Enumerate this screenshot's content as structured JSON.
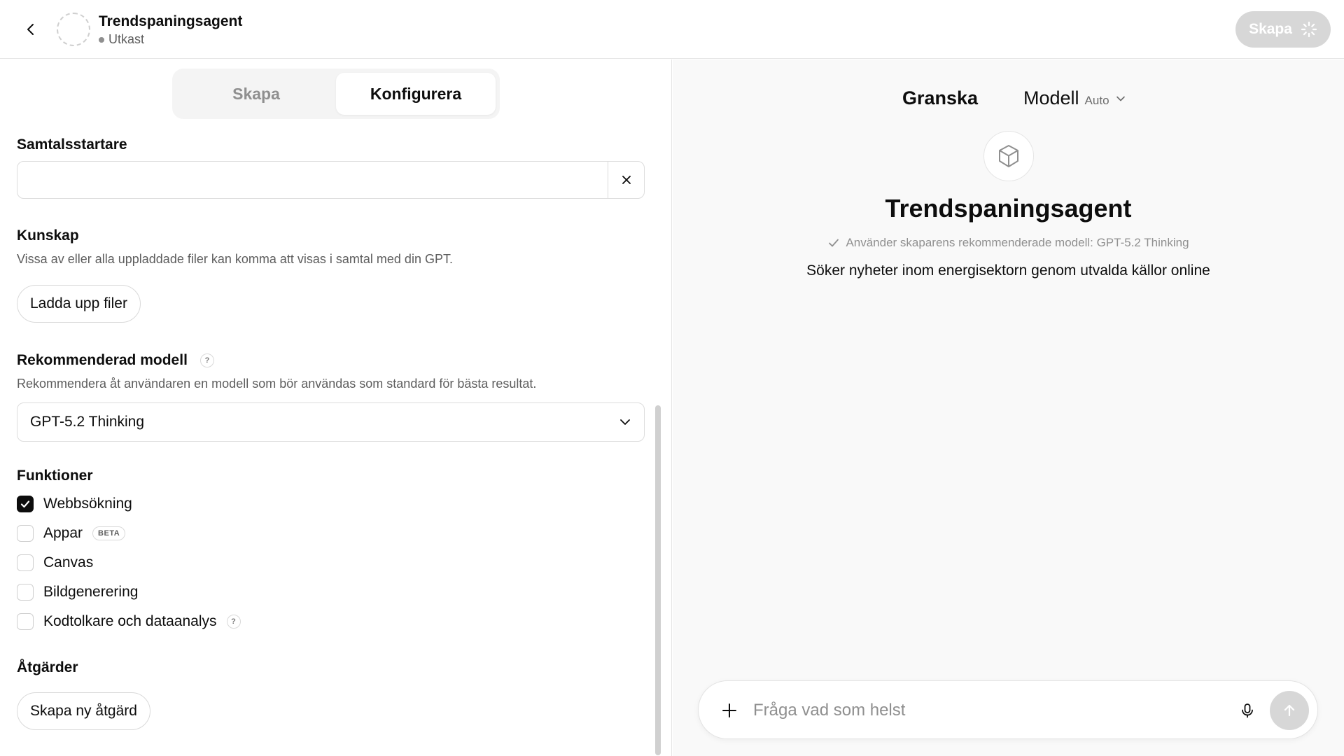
{
  "header": {
    "title": "Trendspaningsagent",
    "status": "Utkast",
    "create_label": "Skapa"
  },
  "tabs": {
    "create": "Skapa",
    "configure": "Konfigurera"
  },
  "config": {
    "starters_label": "Samtalsstartare",
    "starter_value": "",
    "knowledge_label": "Kunskap",
    "knowledge_desc": "Vissa av eller alla uppladdade filer kan komma att visas i samtal med din GPT.",
    "upload_label": "Ladda upp filer",
    "model_label": "Rekommenderad modell",
    "model_desc": "Rekommendera åt användaren en modell som bör användas som standard för bästa resultat.",
    "model_value": "GPT-5.2 Thinking",
    "help_glyph": "?",
    "functions_label": "Funktioner",
    "features": [
      {
        "label": "Webbsökning",
        "checked": true
      },
      {
        "label": "Appar",
        "checked": false,
        "badge": "BETA"
      },
      {
        "label": "Canvas",
        "checked": false
      },
      {
        "label": "Bildgenerering",
        "checked": false
      },
      {
        "label": "Kodtolkare och dataanalys",
        "checked": false
      }
    ],
    "actions_label": "Åtgärder",
    "new_action_label": "Skapa ny åtgärd"
  },
  "preview": {
    "tab_label": "Granska",
    "model_label": "Modell",
    "model_value": "Auto",
    "gpt_name": "Trendspaningsagent",
    "recommended_text": "Använder skaparens rekommenderade modell: GPT-5.2 Thinking",
    "description": "Söker nyheter inom energisektorn genom utvalda källor online",
    "composer_placeholder": "Fråga vad som helst"
  },
  "colors": {
    "accent_dark": "#0d0d0d",
    "disabled_button": "#d7d7d7",
    "preview_bg": "#f9f9f9"
  },
  "icons": [
    "back-chevron-icon",
    "spinner-icon",
    "close-icon",
    "chevron-down-icon",
    "check-icon",
    "cube-icon",
    "plus-icon",
    "mic-icon",
    "arrow-up-icon"
  ]
}
